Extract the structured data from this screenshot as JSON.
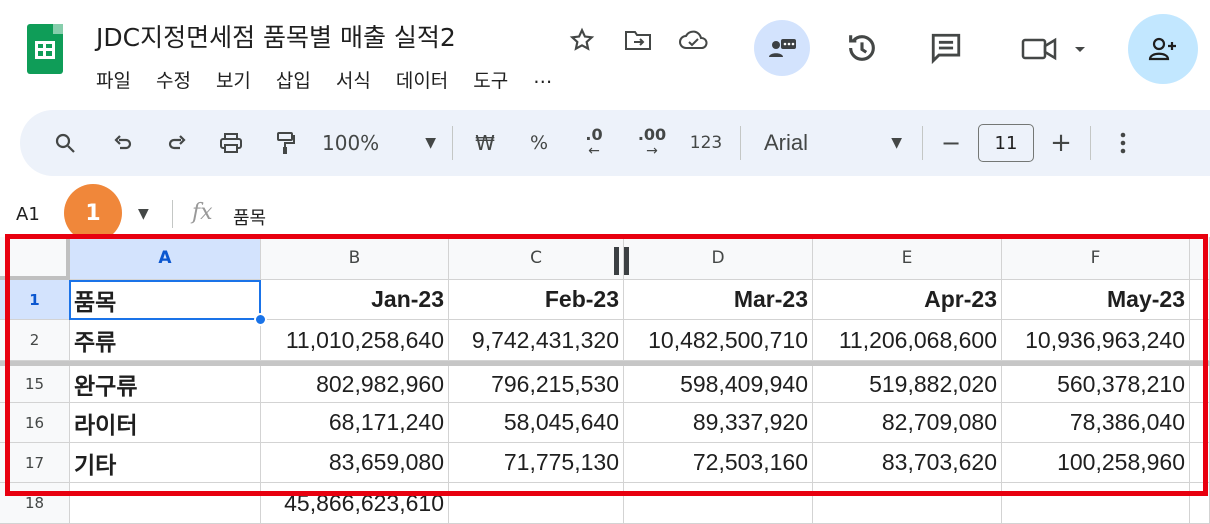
{
  "app": {
    "title": "JDC지정면세점 품목별 매출 실적2"
  },
  "menu": [
    "파일",
    "수정",
    "보기",
    "삽입",
    "서식",
    "데이터",
    "도구",
    "…"
  ],
  "toolbar": {
    "zoom": "100%",
    "currency": "₩",
    "percent": "%",
    "dec_decrease": ".0",
    "dec_increase": ".00",
    "format_123": "123",
    "font": "Arial",
    "font_size": "11",
    "minus": "−",
    "plus": "+"
  },
  "formula_bar": {
    "cell_ref": "A1",
    "badge": "1",
    "fx": "fx",
    "value": "품목"
  },
  "columns": [
    "A",
    "B",
    "C",
    "D",
    "E",
    "F"
  ],
  "rows": [
    {
      "num": "1",
      "cells": [
        "품목",
        "Jan-23",
        "Feb-23",
        "Mar-23",
        "Apr-23",
        "May-23"
      ]
    },
    {
      "num": "2",
      "cells": [
        "주류",
        "11,010,258,640",
        "9,742,431,320",
        "10,482,500,710",
        "11,206,068,600",
        "10,936,963,240"
      ]
    },
    {
      "num": "15",
      "cells": [
        "완구류",
        "802,982,960",
        "796,215,530",
        "598,409,940",
        "519,882,020",
        "560,378,210"
      ]
    },
    {
      "num": "16",
      "cells": [
        "라이터",
        "68,171,240",
        "58,045,640",
        "89,337,920",
        "82,709,080",
        "78,386,040"
      ]
    },
    {
      "num": "17",
      "cells": [
        "기타",
        "83,659,080",
        "71,775,130",
        "72,503,160",
        "83,703,620",
        "100,258,960"
      ]
    },
    {
      "num": "18",
      "cells": [
        "",
        "45,866,623,610",
        "",
        "",
        "",
        ""
      ]
    }
  ],
  "colors": {
    "accent": "#1a73e8",
    "highlight_box": "#e8000f",
    "badge": "#f0873a",
    "toolbar_bg": "#edf2fa"
  }
}
